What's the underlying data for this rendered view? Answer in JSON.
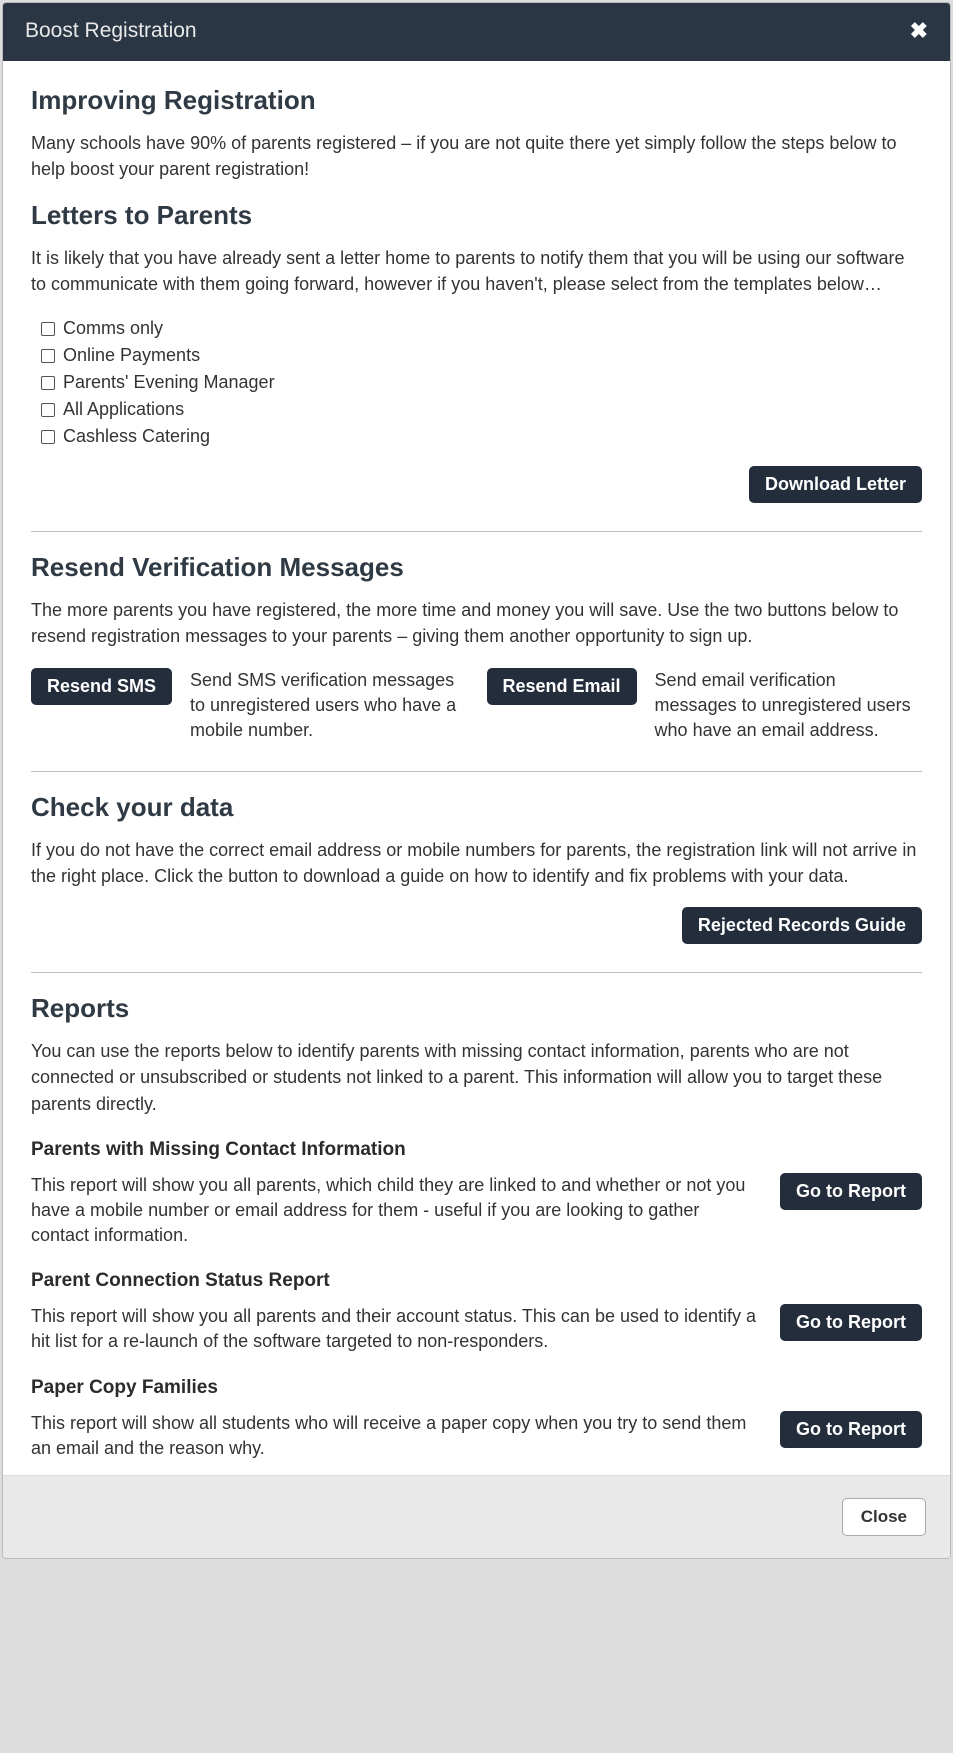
{
  "header": {
    "title": "Boost Registration"
  },
  "intro": {
    "heading": "Improving Registration",
    "text": "Many schools have 90% of parents registered – if you are not quite there yet simply follow the steps below to help boost your parent registration!"
  },
  "letters": {
    "heading": "Letters to Parents",
    "text": "It is likely that you have already sent a letter home to parents to notify them that you will be using our software to communicate with them going forward, however if you haven't, please select from the templates below…",
    "options": [
      "Comms only",
      "Online Payments",
      "Parents' Evening Manager",
      "All Applications",
      "Cashless Catering"
    ],
    "download_label": "Download Letter"
  },
  "resend": {
    "heading": "Resend Verification Messages",
    "text": "The more parents you have registered, the more time and money you will save. Use the two buttons below to resend registration messages to your parents – giving them another opportunity to sign up.",
    "sms_btn": "Resend SMS",
    "sms_desc": "Send SMS verification messages to unregistered users who have a mobile number.",
    "email_btn": "Resend Email",
    "email_desc": "Send email verification messages to unregistered users who have an email address."
  },
  "check": {
    "heading": "Check your data",
    "text": "If you do not have the correct email address or mobile numbers for parents, the registration link will not arrive in the right place. Click the button to download a guide on how to identify and fix problems with your data.",
    "guide_btn": "Rejected Records Guide"
  },
  "reports": {
    "heading": "Reports",
    "text": "You can use the reports below to identify parents with missing contact information, parents who are not connected or unsubscribed or students not linked to a parent. This information will allow you to target these parents directly.",
    "go_label": "Go to Report",
    "items": [
      {
        "title": "Parents with Missing Contact Information",
        "desc": "This report will show you all parents, which child they are linked to and whether or not you have a mobile number or email address for them - useful if you are looking to gather contact information."
      },
      {
        "title": "Parent Connection Status Report",
        "desc": "This report will show you all parents and their account status. This can be used to identify a hit list for a re-launch of the software targeted to non-responders."
      },
      {
        "title": "Paper Copy Families",
        "desc": "This report will show all students who will receive a paper copy when you try to send them an email and the reason why."
      }
    ]
  },
  "footer": {
    "close_label": "Close"
  }
}
